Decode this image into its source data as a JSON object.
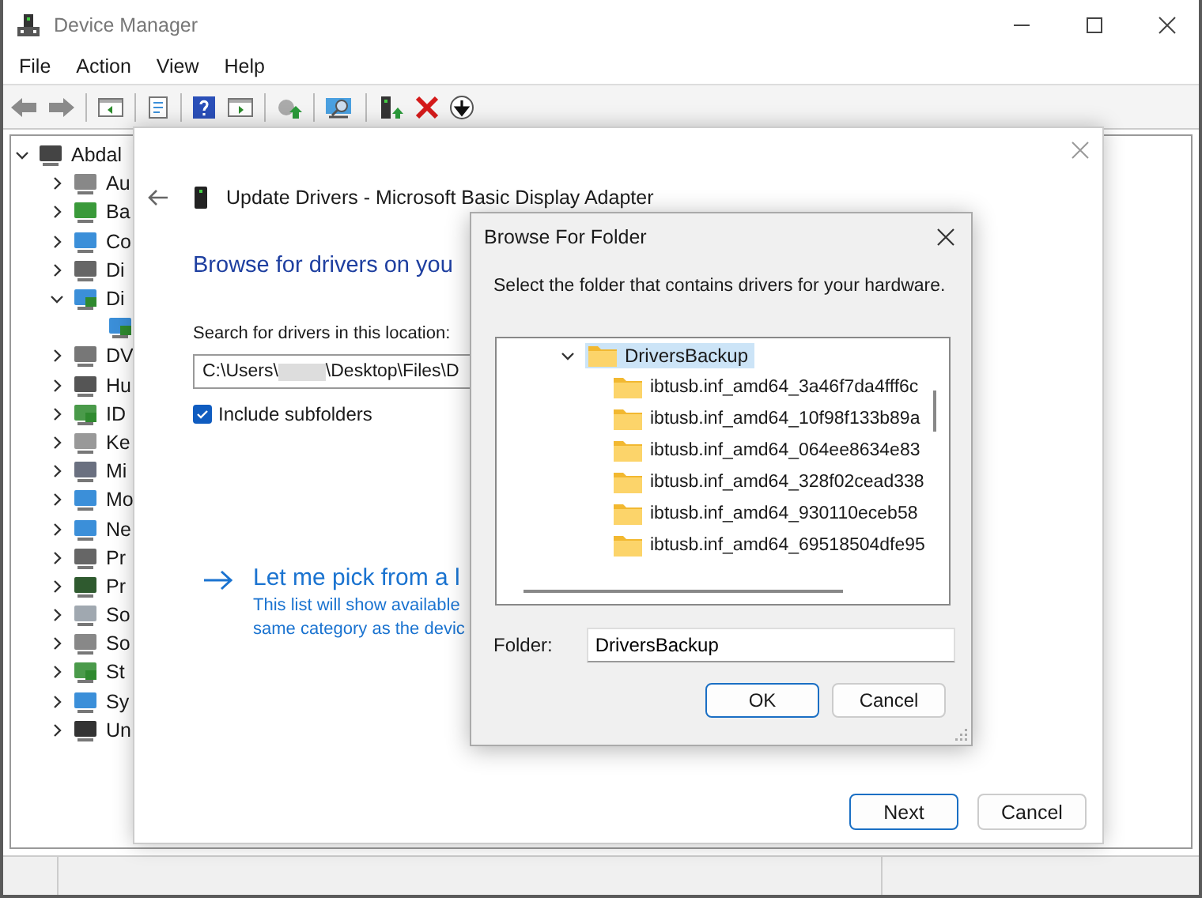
{
  "window": {
    "title": "Device Manager"
  },
  "menu": [
    "File",
    "Action",
    "View",
    "Help"
  ],
  "tree": {
    "label": "Abdal",
    "kind": "computer",
    "expanded": true,
    "children": [
      {
        "label": "Au",
        "kind": "audio",
        "expanded": false
      },
      {
        "label": "Ba",
        "kind": "battery",
        "expanded": false
      },
      {
        "label": "Co",
        "kind": "monitor",
        "expanded": false
      },
      {
        "label": "Di",
        "kind": "disk",
        "expanded": false
      },
      {
        "label": "Di",
        "kind": "display",
        "expanded": true,
        "children": [
          {
            "kind": "display"
          }
        ]
      },
      {
        "label": "DV",
        "kind": "dvd",
        "expanded": false
      },
      {
        "label": "Hu",
        "kind": "hid",
        "expanded": false
      },
      {
        "label": "ID",
        "kind": "ide",
        "expanded": false
      },
      {
        "label": "Ke",
        "kind": "keyboard",
        "expanded": false
      },
      {
        "label": "Mi",
        "kind": "mouse",
        "expanded": false
      },
      {
        "label": "Mo",
        "kind": "monitor",
        "expanded": false
      },
      {
        "label": "Ne",
        "kind": "network",
        "expanded": false
      },
      {
        "label": "Pr",
        "kind": "printer",
        "expanded": false
      },
      {
        "label": "Pr",
        "kind": "processor",
        "expanded": false
      },
      {
        "label": "So",
        "kind": "software",
        "expanded": false
      },
      {
        "label": "So",
        "kind": "audio",
        "expanded": false
      },
      {
        "label": "St",
        "kind": "storage",
        "expanded": false
      },
      {
        "label": "Sy",
        "kind": "system",
        "expanded": false
      },
      {
        "label": "Un",
        "kind": "usb",
        "expanded": false
      }
    ]
  },
  "update_dialog": {
    "title": "Update Drivers - Microsoft Basic Display Adapter",
    "heading": "Browse for drivers on you",
    "search_label": "Search for drivers in this location:",
    "path_prefix": "C:\\Users\\",
    "path_suffix": "\\Desktop\\Files\\D",
    "include_subfolders": {
      "label": "Include subfolders",
      "checked": true
    },
    "pick_link": "Let me pick from a l",
    "pick_description": [
      "This list will show available",
      "same category as the devic"
    ],
    "buttons": [
      {
        "label": "Next",
        "default": true
      },
      {
        "label": "Cancel",
        "default": false
      }
    ]
  },
  "browse_dialog": {
    "title": "Browse For Folder",
    "prompt": "Select the folder that contains drivers for your hardware.",
    "folder_tree": {
      "label": "DriversBackup",
      "expanded": true,
      "selected": true,
      "children": [
        {
          "label": "ibtusb.inf_amd64_3a46f7da4fff6c",
          "selected": false
        },
        {
          "label": "ibtusb.inf_amd64_10f98f133b89a",
          "selected": false
        },
        {
          "label": "ibtusb.inf_amd64_064ee8634e83",
          "selected": false
        },
        {
          "label": "ibtusb.inf_amd64_328f02cead338",
          "selected": false
        },
        {
          "label": "ibtusb.inf_amd64_930110eceb58",
          "selected": false
        },
        {
          "label": "ibtusb.inf_amd64_69518504dfe95",
          "selected": false
        }
      ]
    },
    "folder_label": "Folder:",
    "folder_value": "DriversBackup",
    "buttons": [
      {
        "label": "OK",
        "default": true
      },
      {
        "label": "Cancel",
        "default": false
      }
    ]
  }
}
